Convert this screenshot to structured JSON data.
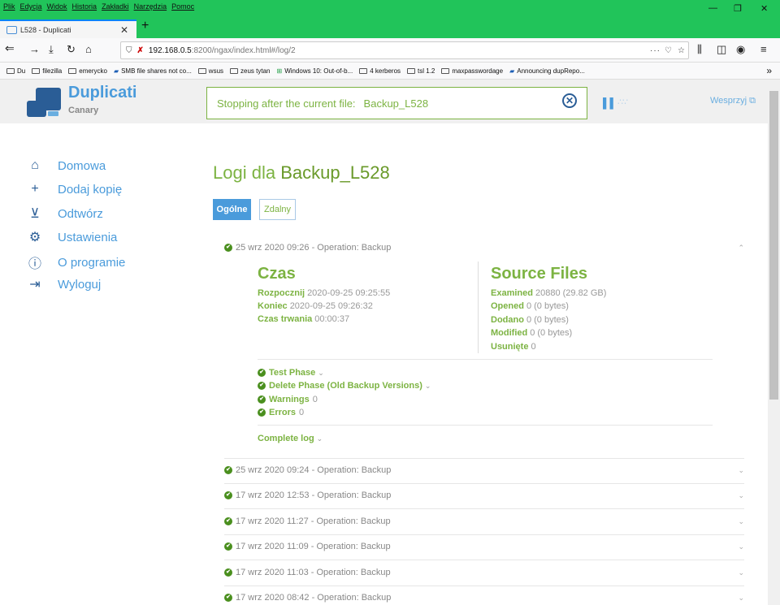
{
  "browser": {
    "menu": [
      "Plik",
      "Edycja",
      "Widok",
      "Historia",
      "Zakładki",
      "Narzędzia",
      "Pomoc"
    ],
    "tab_title": "L528 - Duplicati",
    "url_host": "192.168.0.5",
    "url_rest": ":8200/ngax/index.html#/log/2",
    "bookmarks": [
      "Du",
      "filezilla",
      "emerycko",
      "SMB file shares not co...",
      "wsus",
      "zeus tytan",
      "Windows 10: Out-of-b...",
      "4 kerberos",
      "tsl 1.2",
      "maxpasswordage",
      "Announcing dupRepo..."
    ],
    "accent": "#21c45a"
  },
  "app": {
    "title": "Duplicati",
    "subtitle": "Canary",
    "status_label": "Stopping after the current file:",
    "status_value": "Backup_L528",
    "donate": "Wesprzyj"
  },
  "sidebar": [
    {
      "label": "Domowa",
      "icon": "home-icon"
    },
    {
      "label": "Dodaj kopię",
      "icon": "plus-icon"
    },
    {
      "label": "Odtwórz",
      "icon": "restore-icon"
    },
    {
      "label": "Ustawienia",
      "icon": "gear-icon"
    },
    {
      "label": "O programie",
      "icon": "info-icon"
    },
    {
      "label": "Wyloguj",
      "icon": "logout-icon"
    }
  ],
  "page": {
    "title_prefix": "Logi dla",
    "title_name": "Backup_L528",
    "tabs": [
      "Ogólne",
      "Zdalny"
    ]
  },
  "expanded": {
    "header": "25 wrz 2020 09:26 - Operation: Backup",
    "time_title": "Czas",
    "start_k": "Rozpocznij",
    "start_v": "2020-09-25 09:25:55",
    "end_k": "Koniec",
    "end_v": "2020-09-25 09:26:32",
    "dur_k": "Czas trwania",
    "dur_v": "00:00:37",
    "src_title": "Source Files",
    "examined_k": "Examined",
    "examined_v": "20880 (29.82 GB)",
    "opened_k": "Opened",
    "opened_v": "0 (0 bytes)",
    "added_k": "Dodano",
    "added_v": "0 (0 bytes)",
    "modified_k": "Modified",
    "modified_v": "0 (0 bytes)",
    "deleted_k": "Usunięte",
    "deleted_v": "0",
    "test_phase": "Test Phase",
    "delete_phase": "Delete Phase (Old Backup Versions)",
    "warnings_k": "Warnings",
    "warnings_v": "0",
    "errors_k": "Errors",
    "errors_v": "0",
    "complete_log": "Complete log"
  },
  "logs": [
    "25 wrz 2020 09:24 - Operation: Backup",
    "17 wrz 2020 12:53 - Operation: Backup",
    "17 wrz 2020 11:27 - Operation: Backup",
    "17 wrz 2020 11:09 - Operation: Backup",
    "17 wrz 2020 11:03 - Operation: Backup",
    "17 wrz 2020 08:42 - Operation: Backup"
  ]
}
